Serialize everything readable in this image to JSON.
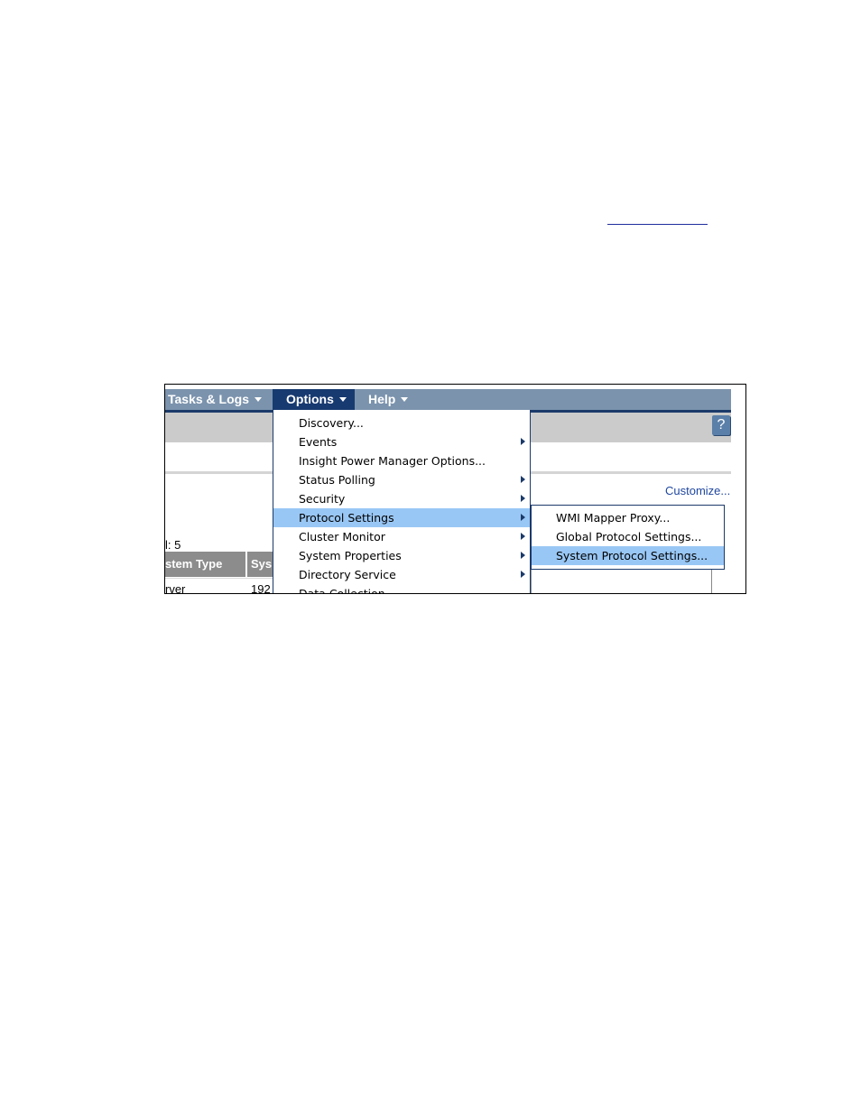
{
  "menubar": {
    "items": [
      {
        "label": "Tasks & Logs"
      },
      {
        "label": "Options"
      },
      {
        "label": "Help"
      }
    ]
  },
  "header": {
    "help_icon_label": "?"
  },
  "content": {
    "customize_link": "Customize...",
    "total_label": "l: 5",
    "table": {
      "columns": [
        "stem Type",
        "Sys"
      ],
      "rows": [
        {
          "type": "rver",
          "sys": "192"
        }
      ]
    }
  },
  "options_menu": {
    "items": [
      {
        "label": "Discovery...",
        "has_submenu": false
      },
      {
        "label": "Events",
        "has_submenu": true
      },
      {
        "label": "Insight Power Manager Options...",
        "has_submenu": false
      },
      {
        "label": "Status Polling",
        "has_submenu": true
      },
      {
        "label": "Security",
        "has_submenu": true
      },
      {
        "label": "Protocol Settings",
        "has_submenu": true,
        "highlighted": true
      },
      {
        "label": "Cluster Monitor",
        "has_submenu": true
      },
      {
        "label": "System Properties",
        "has_submenu": true
      },
      {
        "label": "Directory Service",
        "has_submenu": true
      },
      {
        "label": "Data Collection",
        "has_submenu": false
      }
    ]
  },
  "protocol_submenu": {
    "items": [
      {
        "label": "WMI Mapper Proxy..."
      },
      {
        "label": "Global Protocol Settings..."
      },
      {
        "label": "System Protocol Settings...",
        "highlighted": true
      }
    ]
  },
  "colors": {
    "menubar": "#7b93ad",
    "menubar_active": "#173a70",
    "highlight": "#99c7f5",
    "link": "#1f47a0"
  }
}
